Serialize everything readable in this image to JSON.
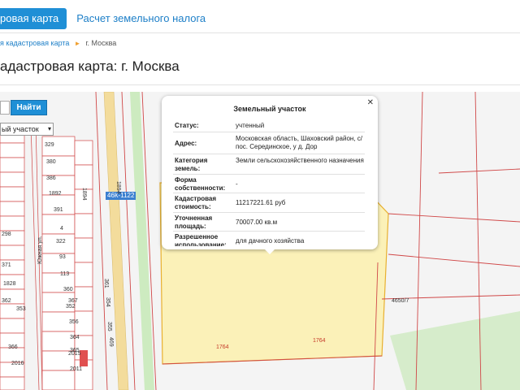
{
  "tabs": {
    "active": "ровая карта",
    "tax": "Расчет земельного налога"
  },
  "breadcrumb": {
    "link": "я кадастровая карта",
    "current": "г. Москва"
  },
  "page_title": "адастровая карта: г. Москва",
  "search": {
    "find_button": "Найти",
    "type_value": "ый участок"
  },
  "map": {
    "road_label": "46К-1122",
    "labels": [
      {
        "t": "329"
      },
      {
        "t": "380"
      },
      {
        "t": "386"
      },
      {
        "t": "1892"
      },
      {
        "t": "391"
      },
      {
        "t": "4"
      },
      {
        "t": "322"
      },
      {
        "t": "93"
      },
      {
        "t": "113"
      },
      {
        "t": "360"
      },
      {
        "t": "367"
      },
      {
        "t": "352"
      },
      {
        "t": "356"
      },
      {
        "t": "364"
      },
      {
        "t": "365"
      },
      {
        "t": "2015"
      },
      {
        "t": "2011"
      },
      {
        "t": "2016"
      },
      {
        "t": "371"
      },
      {
        "t": "1828"
      },
      {
        "t": "362"
      },
      {
        "t": "353"
      },
      {
        "t": "366"
      },
      {
        "t": "298"
      },
      {
        "t": "1894"
      },
      {
        "t": "1894"
      },
      {
        "t": "361"
      },
      {
        "t": "354"
      },
      {
        "t": "355"
      },
      {
        "t": "469"
      },
      {
        "t": "4650/7"
      },
      {
        "t": "1764"
      },
      {
        "t": "1764"
      },
      {
        "t": "Южная ул."
      }
    ]
  },
  "popup": {
    "title": "Земельный участок",
    "rows": [
      {
        "key": "Статус:",
        "value": "учтенный"
      },
      {
        "key": "Адрес:",
        "value": "Московская область, Шаховский район, с/пос. Серединское, у д. Дор"
      },
      {
        "key": "Категория земель:",
        "value": "Земли сельскохозяйственного назначения"
      },
      {
        "key": "Форма собственности:",
        "value": "-"
      },
      {
        "key": "Кадастровая стоимость:",
        "value": "11217221.61 руб"
      },
      {
        "key": "Уточненная площадь:",
        "value": "70007.00 кв.м"
      },
      {
        "key": "Разрешенное использование:",
        "value": "для дачного хозяйства"
      }
    ]
  },
  "colors": {
    "accent": "#1f8fd6",
    "parcel": "#fbf1b8",
    "road_green": "#c8e8b8",
    "boundary": "#d04848"
  }
}
